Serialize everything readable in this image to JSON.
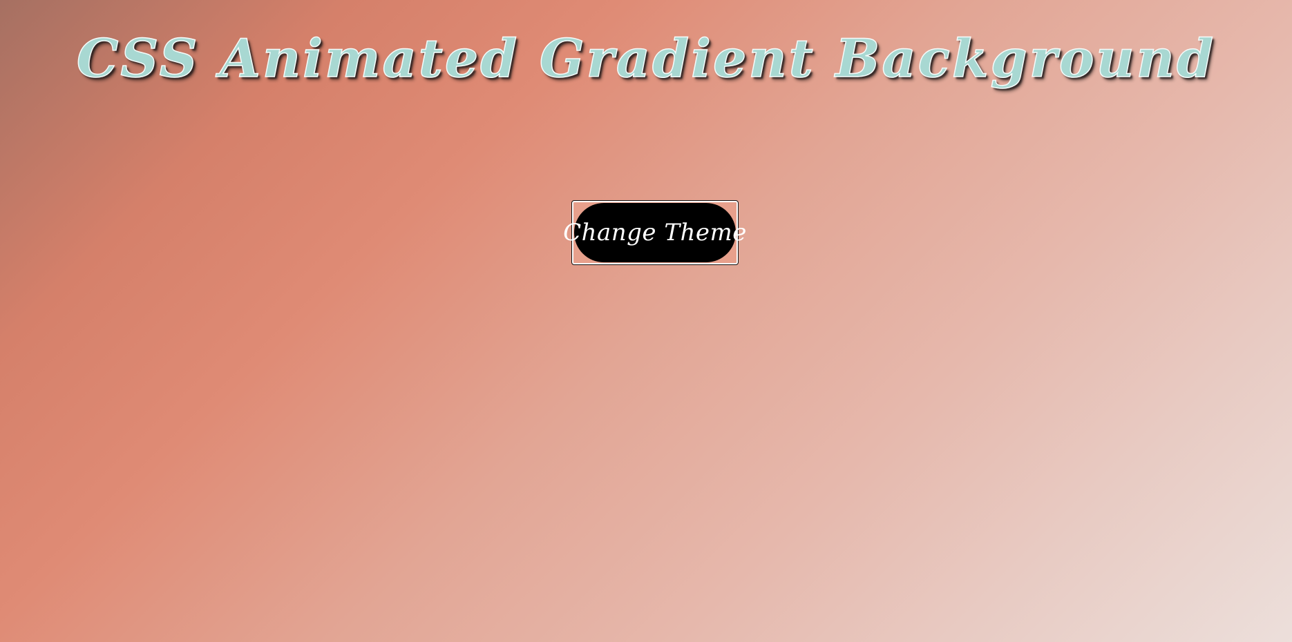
{
  "header": {
    "title": "CSS Animated Gradient Background"
  },
  "controls": {
    "theme_button_label": "Change Theme"
  },
  "colors": {
    "title_fill": "#a8d8d2",
    "button_background": "#000000",
    "button_text": "#ffffff",
    "gradient_start": "#a67062",
    "gradient_mid": "#df8b75",
    "gradient_end": "#ecdfdb"
  }
}
